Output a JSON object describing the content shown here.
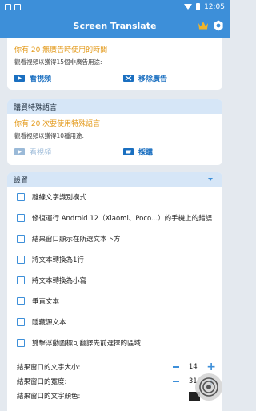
{
  "status_bar": {
    "time": "12:05"
  },
  "app_bar": {
    "title": "Screen Translate"
  },
  "colors": {
    "accent": "#3d8fd9",
    "warning": "#e39a1b",
    "link": "#1a6fc0"
  },
  "ad_card": {
    "line1": "你有 20 無廣告時使用的時間",
    "line2": "觀看視頻以獲得15個非廣告用途:",
    "watch_label": "看視頻",
    "remove_ads_label": "移除廣告"
  },
  "language_card": {
    "header": "購買特殊語言",
    "line1": "你有 20 次要使用特殊語言",
    "line2": "觀看視頻以獲得10種用途:",
    "watch_label": "看視頻",
    "purchase_label": "採購"
  },
  "settings_card": {
    "header": "設置",
    "options": [
      "離線文字識別模式",
      "修復運行 Android 12（Xiaomi、Poco...）的手機上的錯誤",
      "結果窗口顯示在所選文本下方",
      "將文本轉換為1行",
      "將文本轉換為小寫",
      "垂直文本",
      "隱藏源文本",
      "雙擊浮動圖標可翻譯先前選擇的區域"
    ],
    "text_size_label": "結果窗口的文字大小:",
    "text_size_value": "14",
    "width_label": "結果窗口的寬度:",
    "width_value": "31",
    "text_color_label": "結果窗口的文字顏色:",
    "text_color": "#222222"
  }
}
